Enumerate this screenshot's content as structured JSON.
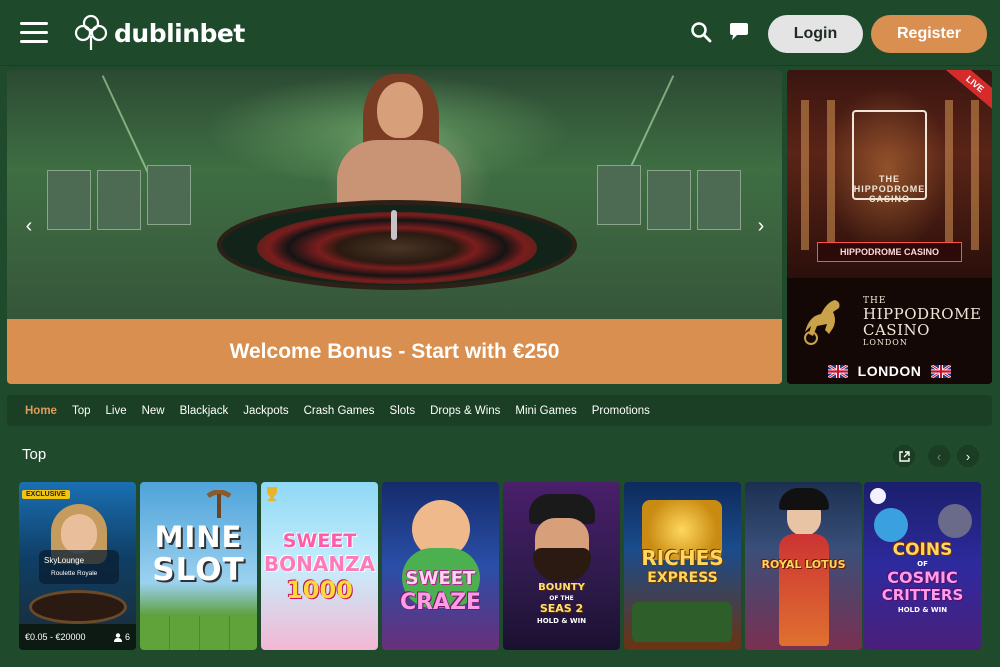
{
  "header": {
    "brand": "dublinbet",
    "login_label": "Login",
    "register_label": "Register",
    "icons": [
      "menu-icon",
      "search-icon",
      "chat-icon"
    ]
  },
  "hero": {
    "banner_text": "Welcome Bonus - Start with €250",
    "prev_icon": "‹",
    "next_icon": "›"
  },
  "side_banner": {
    "badge": "LIVE",
    "sign_text": "THE HIPPODROME CASINO",
    "led_text": "HIPPODROME CASINO",
    "title_small": "THE",
    "title_big_1": "HIPPODROME",
    "title_big_2": "CASINO",
    "title_tiny": "LONDON",
    "city": "LONDON"
  },
  "nav": {
    "items": [
      "Home",
      "Top",
      "Live",
      "New",
      "Blackjack",
      "Jackpots",
      "Crash Games",
      "Slots",
      "Drops & Wins",
      "Mini Games",
      "Promotions"
    ],
    "active": "Home"
  },
  "section": {
    "title": "Top",
    "icons": [
      "external-link-icon",
      "chevron-left-icon",
      "chevron-right-icon"
    ]
  },
  "games": [
    {
      "badge": "EXCLUSIVE",
      "name": "SkyLounge",
      "subtitle": "Roulette Royale",
      "limits": "€0.05 - €20000",
      "players": "6"
    },
    {
      "name_line1": "MINE",
      "name_line2": "SLOT"
    },
    {
      "name_line1": "SWEET",
      "name_line2": "BONANZA",
      "name_line3": "1000"
    },
    {
      "name_line1": "SWEET",
      "name_line2": "CRAZE"
    },
    {
      "name_line1": "BOUNTY",
      "name_mid": "OF THE",
      "name_line2": "SEAS 2",
      "name_line3": "HOLD & WIN"
    },
    {
      "name_line1": "RICHES",
      "name_line2": "EXPRESS"
    },
    {
      "name_line1": "ROYAL LOTUS"
    },
    {
      "name_line1": "COINS",
      "name_mid": "OF",
      "name_line2": "COSMIC",
      "name_line3": "CRITTERS",
      "name_line4": "HOLD & WIN"
    }
  ],
  "colors": {
    "background": "#1f4a2c",
    "accent": "#d98f50",
    "nav_active": "#e59a5a",
    "live": "#d62b2b"
  }
}
